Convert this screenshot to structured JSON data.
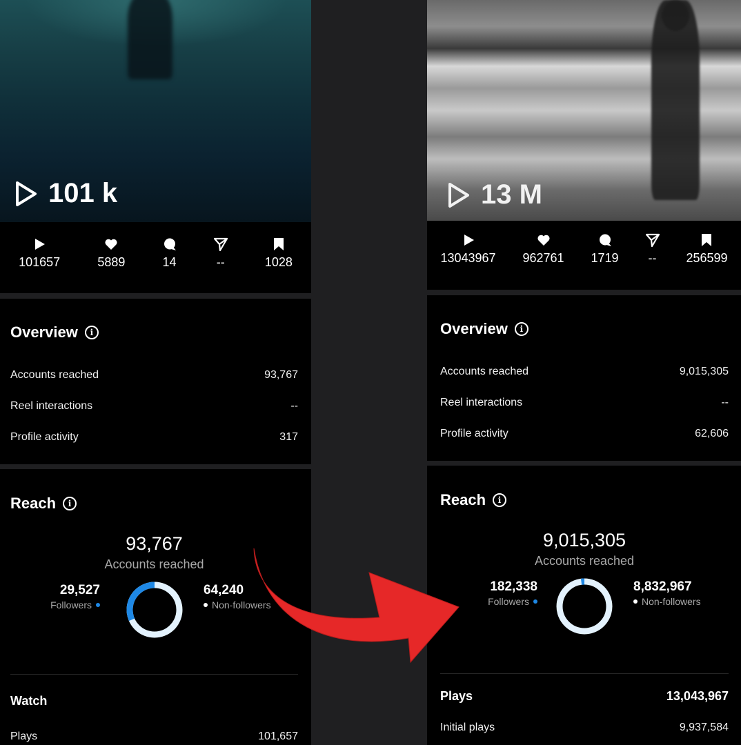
{
  "left": {
    "thumbnail_plays": "101 k",
    "stats": [
      {
        "icon": "play-icon",
        "value": "101657"
      },
      {
        "icon": "heart-icon",
        "value": "5889"
      },
      {
        "icon": "comment-icon",
        "value": "14"
      },
      {
        "icon": "share-icon",
        "value": "--"
      },
      {
        "icon": "bookmark-icon",
        "value": "1028"
      }
    ],
    "overview": {
      "title": "Overview",
      "rows": [
        {
          "label": "Accounts reached",
          "value": "93,767"
        },
        {
          "label": "Reel interactions",
          "value": "--"
        },
        {
          "label": "Profile activity",
          "value": "317"
        }
      ]
    },
    "reach": {
      "title": "Reach",
      "total": "93,767",
      "total_label": "Accounts reached",
      "followers_value": "29,527",
      "followers_label": "Followers",
      "nonfollowers_value": "64,240",
      "nonfollowers_label": "Non-followers",
      "followers_fraction": 0.315
    },
    "watch": {
      "title": "Watch",
      "plays_label": "Plays",
      "plays_value": "101,657"
    }
  },
  "right": {
    "thumbnail_plays": "13 M",
    "stats": [
      {
        "icon": "play-icon",
        "value": "13043967"
      },
      {
        "icon": "heart-icon",
        "value": "962761"
      },
      {
        "icon": "comment-icon",
        "value": "1719"
      },
      {
        "icon": "share-icon",
        "value": "--"
      },
      {
        "icon": "bookmark-icon",
        "value": "256599"
      }
    ],
    "overview": {
      "title": "Overview",
      "rows": [
        {
          "label": "Accounts reached",
          "value": "9,015,305"
        },
        {
          "label": "Reel interactions",
          "value": "--"
        },
        {
          "label": "Profile activity",
          "value": "62,606"
        }
      ]
    },
    "reach": {
      "title": "Reach",
      "total": "9,015,305",
      "total_label": "Accounts reached",
      "followers_value": "182,338",
      "followers_label": "Followers",
      "nonfollowers_value": "8,832,967",
      "nonfollowers_label": "Non-followers",
      "followers_fraction": 0.02
    },
    "plays": {
      "plays_label": "Plays",
      "plays_value": "13,043,967",
      "initial_plays_label": "Initial plays",
      "initial_plays_value": "9,937,584"
    }
  },
  "colors": {
    "followers": "#1e88e5",
    "nonfollowers": "#e3f2fd",
    "arrow": "#e62828",
    "card_bg": "#000000",
    "page_bg": "#1f1f21"
  }
}
